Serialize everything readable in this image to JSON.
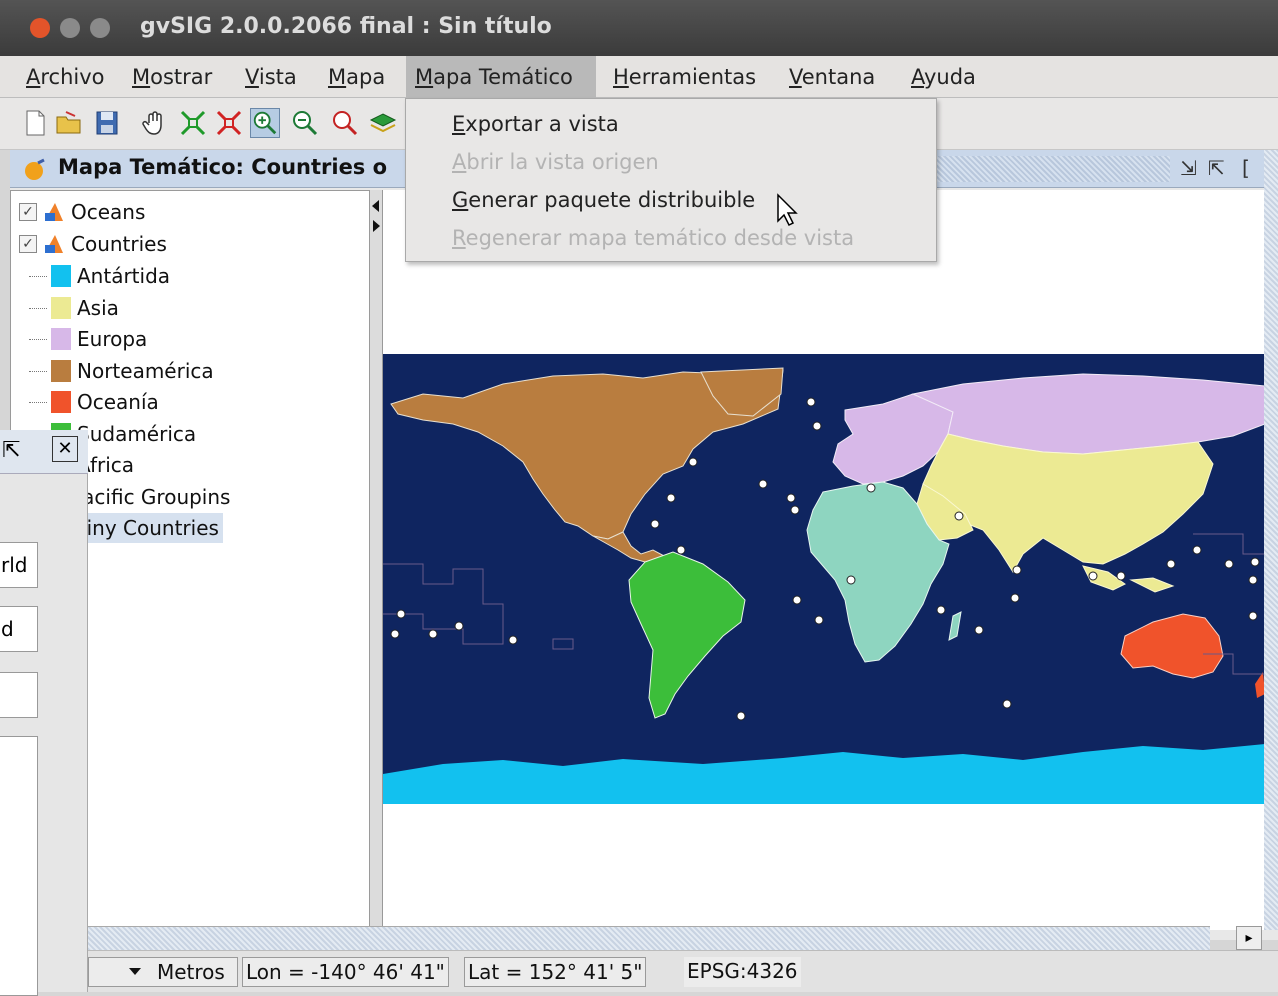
{
  "window": {
    "title": "gvSIG 2.0.0.2066 final : Sin título"
  },
  "menu": {
    "items": [
      {
        "accel": "A",
        "rest": "rchivo"
      },
      {
        "accel": "M",
        "rest": "ostrar"
      },
      {
        "accel": "V",
        "rest": "ista"
      },
      {
        "accel": "M",
        "rest": "apa"
      },
      {
        "accel": "M",
        "rest": "apa Temático"
      },
      {
        "accel": "H",
        "rest": "erramientas"
      },
      {
        "accel": "V",
        "rest": "entana"
      },
      {
        "accel": "A",
        "rest": "yuda"
      }
    ]
  },
  "dropdown": {
    "items": [
      {
        "accel": "E",
        "rest": "xportar a vista",
        "enabled": true
      },
      {
        "accel": "A",
        "rest": "brir la vista origen",
        "enabled": false
      },
      {
        "accel": "G",
        "rest": "enerar paquete distribuible",
        "enabled": true
      },
      {
        "accel": "R",
        "rest": "egenerar mapa temático desde vista",
        "enabled": false
      }
    ]
  },
  "frame": {
    "title": "Mapa Temático: Countries o"
  },
  "toc": {
    "layers": [
      {
        "label": "Oceans",
        "checked": true
      },
      {
        "label": "Countries",
        "checked": true
      }
    ],
    "legend": [
      {
        "label": "Antártida",
        "color": "#12c1ef"
      },
      {
        "label": "Asia",
        "color": "#ecea93"
      },
      {
        "label": "Europa",
        "color": "#d7b8e8"
      },
      {
        "label": "Norteamérica",
        "color": "#b97d3f"
      },
      {
        "label": "Oceanía",
        "color": "#f0532b"
      },
      {
        "label": "Sudamérica",
        "color": "#3cbe3a"
      },
      {
        "label": "África",
        "color": "#8ed5c0"
      }
    ],
    "extra": [
      "Pacific Groupins",
      "Tiny Countries"
    ]
  },
  "left_window": {
    "fields": [
      "rld",
      "d",
      ""
    ]
  },
  "statusbar": {
    "units": "Metros",
    "lon": "Lon = -140° 46' 41\"",
    "lat": "Lat = 152° 41' 5\"",
    "crs": "EPSG:4326"
  },
  "colors": {
    "ocean": "#0f2560",
    "antarctica": "#12c1ef"
  }
}
